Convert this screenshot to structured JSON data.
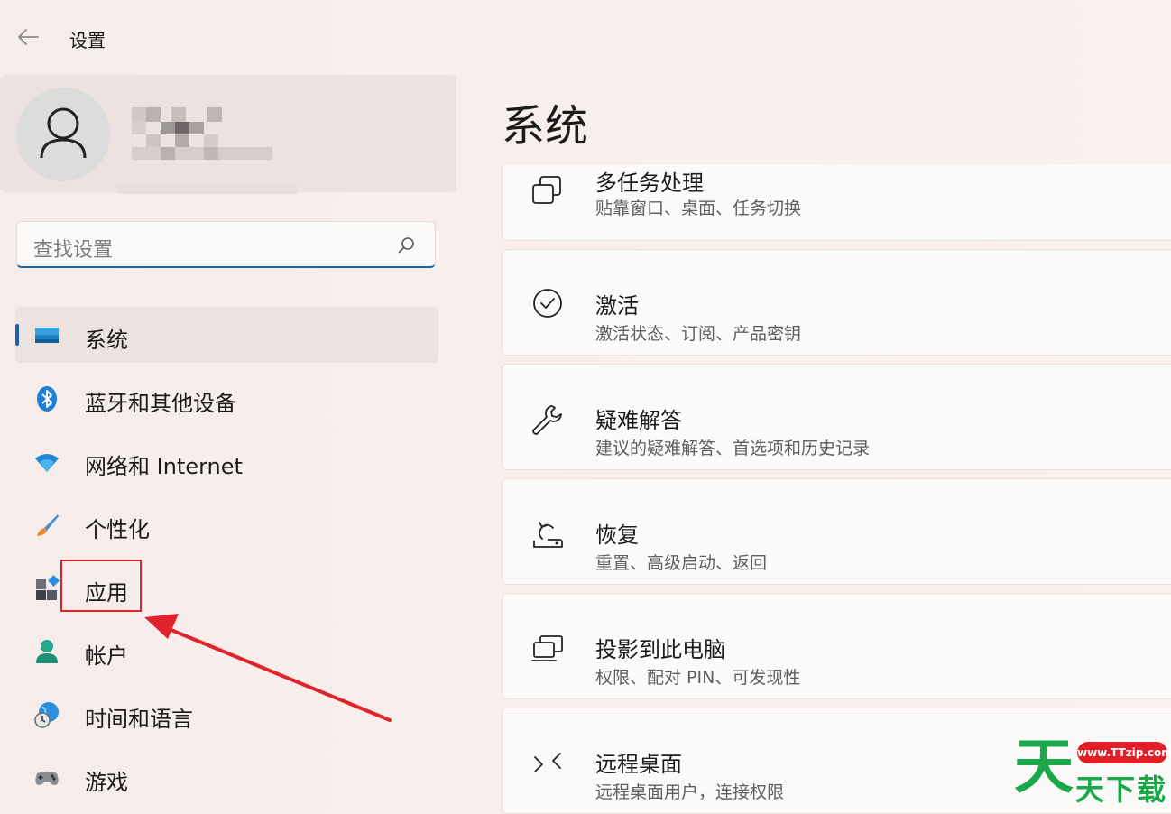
{
  "window": {
    "title": "设置"
  },
  "search": {
    "placeholder": "查找设置"
  },
  "sidebar": {
    "items": [
      {
        "label": "系统",
        "icon": "system-icon",
        "active": true
      },
      {
        "label": "蓝牙和其他设备",
        "icon": "bluetooth-icon"
      },
      {
        "label": "网络和 Internet",
        "icon": "wifi-icon"
      },
      {
        "label": "个性化",
        "icon": "brush-icon"
      },
      {
        "label": "应用",
        "icon": "apps-icon"
      },
      {
        "label": "帐户",
        "icon": "account-icon"
      },
      {
        "label": "时间和语言",
        "icon": "clock-globe-icon"
      },
      {
        "label": "游戏",
        "icon": "gamepad-icon"
      }
    ]
  },
  "main": {
    "title": "系统",
    "cards": [
      {
        "title": "多任务处理",
        "subtitle": "贴靠窗口、桌面、任务切换",
        "icon": "multitask-icon"
      },
      {
        "title": "激活",
        "subtitle": "激活状态、订阅、产品密钥",
        "icon": "check-circle-icon"
      },
      {
        "title": "疑难解答",
        "subtitle": "建议的疑难解答、首选项和历史记录",
        "icon": "wrench-icon"
      },
      {
        "title": "恢复",
        "subtitle": "重置、高级启动、返回",
        "icon": "recovery-icon"
      },
      {
        "title": "投影到此电脑",
        "subtitle": "权限、配对 PIN、可发现性",
        "icon": "project-icon"
      },
      {
        "title": "远程桌面",
        "subtitle": "远程桌面用户，连接权限",
        "icon": "remote-desktop-icon"
      }
    ]
  },
  "watermark": {
    "url": "www.TTzip.com",
    "big": "天",
    "small": "天下载"
  },
  "colors": {
    "accent": "#1d5fa8",
    "highlight": "#e0242b",
    "watermark_green": "#1aa84b"
  }
}
